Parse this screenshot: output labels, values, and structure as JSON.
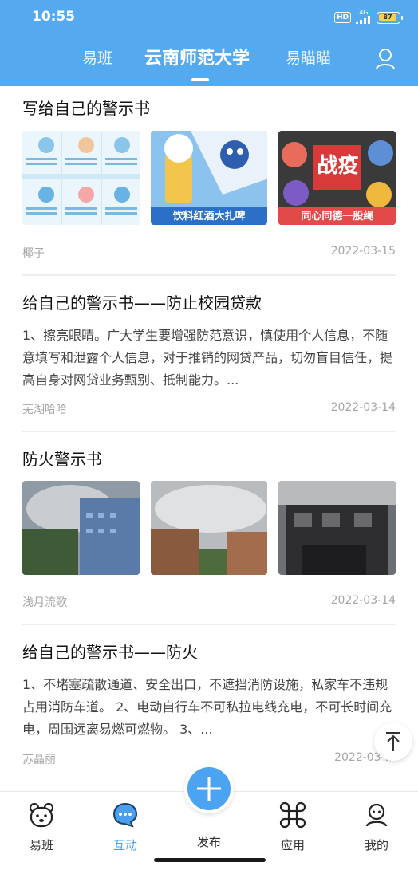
{
  "status_bar": {
    "time": "10:55",
    "hd": "HD",
    "network": "4G",
    "battery": "87"
  },
  "header": {
    "tabs": [
      {
        "label": "易班"
      },
      {
        "label": "云南师范大学"
      },
      {
        "label": "易瞄瞄"
      }
    ]
  },
  "posts": [
    {
      "title": "写给自己的警示书",
      "author": "椰子",
      "date": "2022-03-15",
      "image_captions": [
        "饮料红酒大扎啤",
        "同心同德一股绳"
      ],
      "image_text": [
        "战疫"
      ]
    },
    {
      "title": "给自己的警示书——防止校园贷款",
      "body": "1、擦亮眼睛。广大学生要增强防范意识，慎使用个人信息，不随意填写和泄露个人信息，对于推销的网贷产品，切勿盲目信任，提高自身对网贷业务甄别、抵制能力。...",
      "author": "芜湖哈哈",
      "date": "2022-03-14"
    },
    {
      "title": "防火警示书",
      "author": "浅月流歌",
      "date": "2022-03-14"
    },
    {
      "title": "给自己的警示书——防火",
      "body": "1、不堵塞疏散通道、安全出口，不遮挡消防设施，私家车不违规占用消防车道。 2、电动自行车不可私拉电线充电，不可长时间充电，周围远离易燃可燃物。    3、...",
      "author": "苏晶丽",
      "date": "2022-03-..."
    }
  ],
  "bottom_nav": {
    "items": [
      {
        "label": "易班",
        "icon": "bear-icon"
      },
      {
        "label": "互动",
        "icon": "chat-bubble-icon"
      },
      {
        "label": "发布",
        "icon": "plus-icon"
      },
      {
        "label": "应用",
        "icon": "command-icon"
      },
      {
        "label": "我的",
        "icon": "person-icon"
      }
    ],
    "active": "互动"
  },
  "colors": {
    "header_bg": "#55a9ef",
    "accent": "#4a9ff0",
    "meta_text": "#a6a6a6"
  }
}
